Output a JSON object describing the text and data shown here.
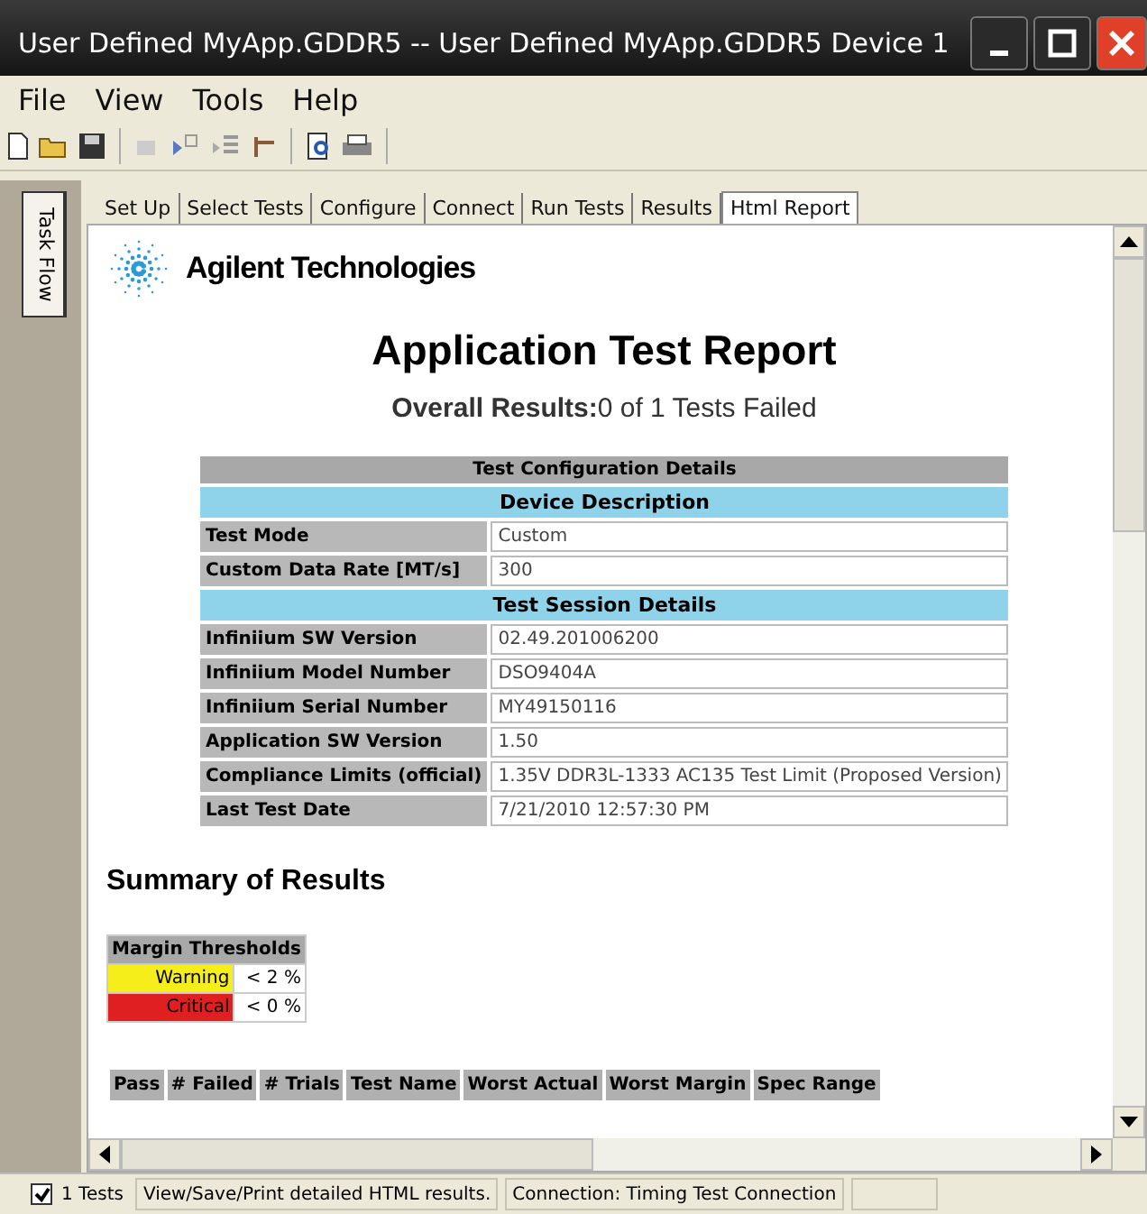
{
  "window": {
    "title": "User Defined MyApp.GDDR5 -- User Defined MyApp.GDDR5 Device 1"
  },
  "menu": [
    "File",
    "View",
    "Tools",
    "Help"
  ],
  "side_tab": {
    "label": "Task Flow"
  },
  "tabs": [
    {
      "label": "Set Up",
      "selected": false
    },
    {
      "label": "Select Tests",
      "selected": false
    },
    {
      "label": "Configure",
      "selected": false
    },
    {
      "label": "Connect",
      "selected": false
    },
    {
      "label": "Run Tests",
      "selected": false
    },
    {
      "label": "Results",
      "selected": false
    },
    {
      "label": "Html Report",
      "selected": true
    }
  ],
  "report": {
    "logo": "Agilent Technologies",
    "title": "Application Test Report",
    "overall": "**Overall Results:**0 of 1 Tests Failed",
    "config": {
      "heading": "Test Configuration Details",
      "sections": [
        {
          "title": "Device Description",
          "rows": [
            {
              "label": "Test Mode",
              "value": "Custom"
            },
            {
              "label": "Custom Data Rate [MT/s]",
              "value": "300"
            }
          ]
        },
        {
          "title": "Test Session Details",
          "rows": [
            {
              "label": "Infiniium SW Version",
              "value": "02.49.201006200"
            },
            {
              "label": "Infiniium Model Number",
              "value": "DSO9404A"
            },
            {
              "label": "Infiniium Serial Number",
              "value": "MY49150116"
            },
            {
              "label": "Application SW Version",
              "value": "1.50"
            },
            {
              "label": "Compliance Limits (official)",
              "value": "1.35V DDR3L-1333 AC135 Test Limit (Proposed Version)"
            },
            {
              "label": "Last Test Date",
              "value": "7/21/2010 12:57:30 PM"
            }
          ]
        }
      ]
    },
    "summary_heading": "Summary of Results",
    "thresholds": {
      "heading": "Margin Thresholds",
      "rows": [
        {
          "label": "Warning",
          "value": "< 2 %",
          "color": "#f5ee1a"
        },
        {
          "label": "Critical",
          "value": "< 0 %",
          "color": "#e02020"
        }
      ]
    },
    "results_columns": [
      "Pass",
      "# Failed",
      "# Trials",
      "Test Name",
      "Worst Actual",
      "Worst Margin",
      "Spec Range"
    ]
  },
  "status_bar": {
    "checked": true,
    "tests": "1 Tests",
    "message": "View/Save/Print detailed HTML results.",
    "connection": "Connection: Timing Test Connection"
  }
}
